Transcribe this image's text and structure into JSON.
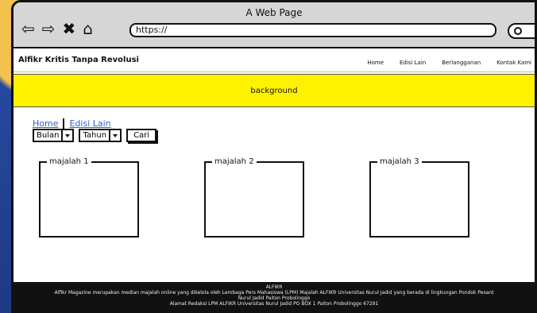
{
  "browser": {
    "window_title": "A Web Page",
    "url": "https://",
    "nav": {
      "back_icon": "⇦",
      "forward_icon": "⇨",
      "close_icon": "✖",
      "home_icon": "⌂"
    }
  },
  "site": {
    "title": "Alfikr Kritis Tanpa Revolusi",
    "nav": [
      "Home",
      "Edisi Lain",
      "Berlangganan",
      "Kontak Kami"
    ]
  },
  "hero": {
    "label": "background"
  },
  "breadcrumb": {
    "home": "Home",
    "current": "Edisi Lain"
  },
  "filters": {
    "month": "Bulan",
    "year": "Tahun",
    "search_button": "Cari"
  },
  "magazines": [
    "majalah 1",
    "majalah 2",
    "majalah 3"
  ],
  "footer": {
    "line1": "ALFIKR",
    "line2": "Alfikr Magazine merupakan median majalah online yang dikelola oleh Lembaga Pers Mahasiswa (LPM) Majalah ALFIKR Universitas Nurul Jadid yang berada di lingkungan Pondok Pesant",
    "line3": "Nurul Jadid Paiton Probolinggo",
    "line4": "Alamat Redaksi LPM ALFIKR Universitas Nurul Jadid PO BOX 1 Paiton Probolinggo 67291"
  }
}
